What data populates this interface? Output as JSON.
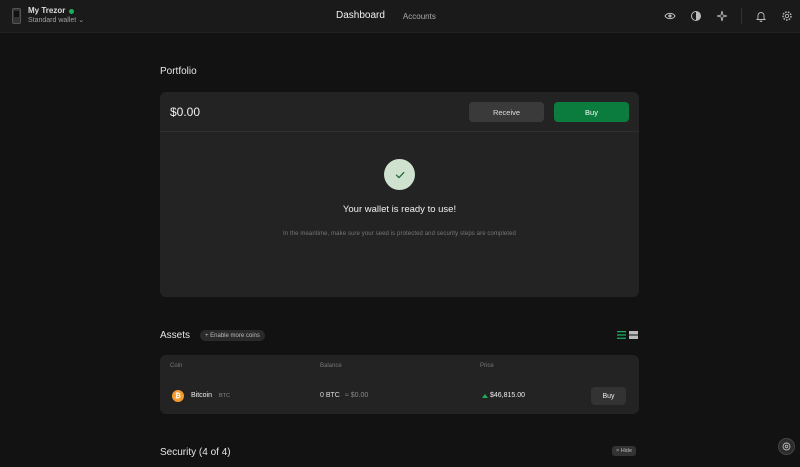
{
  "header": {
    "device_name": "My Trezor",
    "wallet_type": "Standard wallet",
    "nav": [
      "Dashboard",
      "Accounts"
    ]
  },
  "icons": [
    "eye-icon",
    "contrast-icon",
    "sparkle-icon",
    "bell-icon",
    "gear-icon",
    "support-icon",
    "check-icon",
    "bitcoin-icon"
  ],
  "colors": {
    "accent": "#0b7b3e",
    "status": "#1aaf5d",
    "bitcoin": "#f29b2e"
  },
  "portfolio": {
    "title": "Portfolio",
    "balance": "$0.00",
    "receive_label": "Receive",
    "buy_label": "Buy",
    "ready_text": "Your wallet is ready to use!",
    "sub_text": "In the meantime, make sure your seed is protected and security steps are completed"
  },
  "assets": {
    "title": "Assets",
    "enable_label": "+ Enable more coins",
    "columns": [
      "Coin",
      "Balance",
      "Price"
    ],
    "rows": [
      {
        "name": "Bitcoin",
        "symbol": "BTC",
        "balance": "0 BTC",
        "fiat": "≈ $0.00",
        "price": "$46,815.00",
        "buy": "Buy"
      }
    ]
  },
  "security": {
    "title": "Security (4 of 4)",
    "hide_label": "× Hide"
  }
}
